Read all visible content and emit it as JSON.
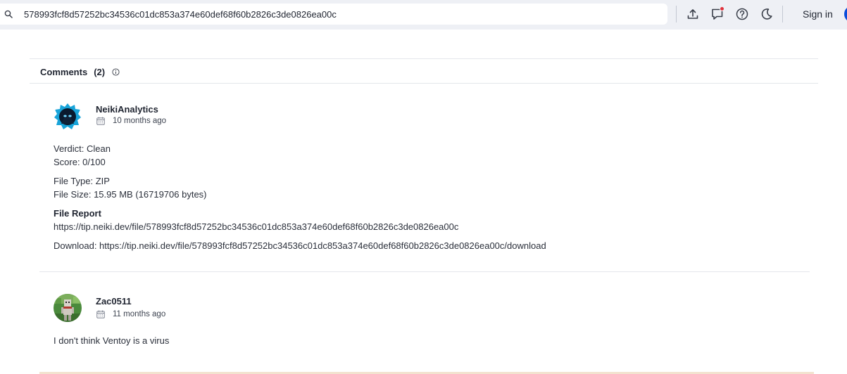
{
  "toolbar": {
    "search_value": "578993fcf8d57252bc34536c01dc853a374e60def68f60b2826c3de0826ea00c",
    "icons": [
      "search-icon",
      "upload-icon",
      "notifications-icon",
      "help-icon",
      "dark-mode-icon"
    ],
    "sign_in_label": "Sign in",
    "notification_dot_color": "#e0323c"
  },
  "comments": {
    "title": "Comments",
    "count": "(2)",
    "items": [
      {
        "author": "NeikiAnalytics",
        "date": "10 months ago",
        "verdict": "Verdict: Clean",
        "score": "Score: 0/100",
        "file_type": "File Type: ZIP",
        "file_size": "File Size: 15.95 MB (16719706 bytes)",
        "report_heading": "File Report",
        "report_url": "https://tip.neiki.dev/file/578993fcf8d57252bc34536c01dc853a374e60def68f60b2826c3de0826ea00c",
        "download": "Download: https://tip.neiki.dev/file/578993fcf8d57252bc34536c01dc853a374e60def68f60b2826c3de0826ea00c/download"
      },
      {
        "author": "Zac0511",
        "date": "11 months ago",
        "text": "I don't think Ventoy is a virus"
      }
    ]
  }
}
